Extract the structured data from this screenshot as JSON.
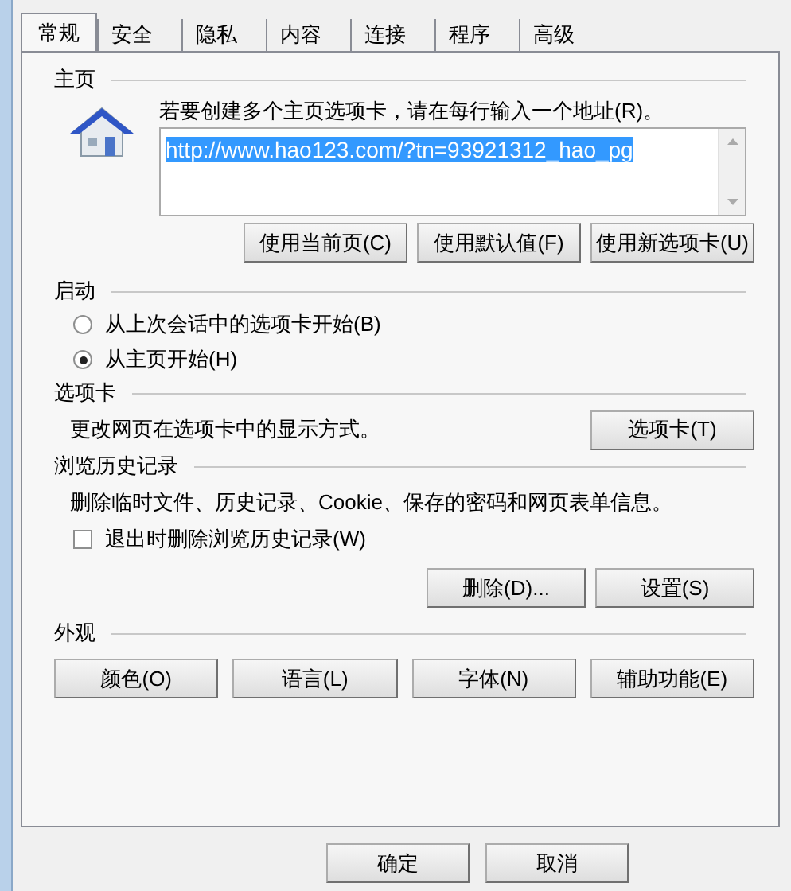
{
  "tabs": [
    {
      "label": "常规",
      "selected": true
    },
    {
      "label": "安全",
      "selected": false
    },
    {
      "label": "隐私",
      "selected": false
    },
    {
      "label": "内容",
      "selected": false
    },
    {
      "label": "连接",
      "selected": false
    },
    {
      "label": "程序",
      "selected": false
    },
    {
      "label": "高级",
      "selected": false
    }
  ],
  "home_page": {
    "label": "主页",
    "instruction": "若要创建多个主页选项卡，请在每行输入一个地址(R)。",
    "url": "http://www.hao123.com/?tn=93921312_hao_pg",
    "url_selected": true,
    "buttons": [
      "使用当前页(C)",
      "使用默认值(F)",
      "使用新选项卡(U)"
    ]
  },
  "startup": {
    "label": "启动",
    "options": [
      {
        "label": "从上次会话中的选项卡开始(B)",
        "selected": false
      },
      {
        "label": "从主页开始(H)",
        "selected": true
      }
    ]
  },
  "tabs_section": {
    "label": "选项卡",
    "description": "更改网页在选项卡中的显示方式。",
    "button": "选项卡(T)"
  },
  "history": {
    "label": "浏览历史记录",
    "description": "删除临时文件、历史记录、Cookie、保存的密码和网页表单信息。",
    "checkbox": {
      "label": "退出时删除浏览历史记录(W)",
      "checked": false
    },
    "buttons": [
      "删除(D)...",
      "设置(S)"
    ]
  },
  "appearance": {
    "label": "外观",
    "buttons": [
      "颜色(O)",
      "语言(L)",
      "字体(N)",
      "辅助功能(E)"
    ]
  },
  "dialog_buttons": [
    "确定",
    "取消"
  ]
}
